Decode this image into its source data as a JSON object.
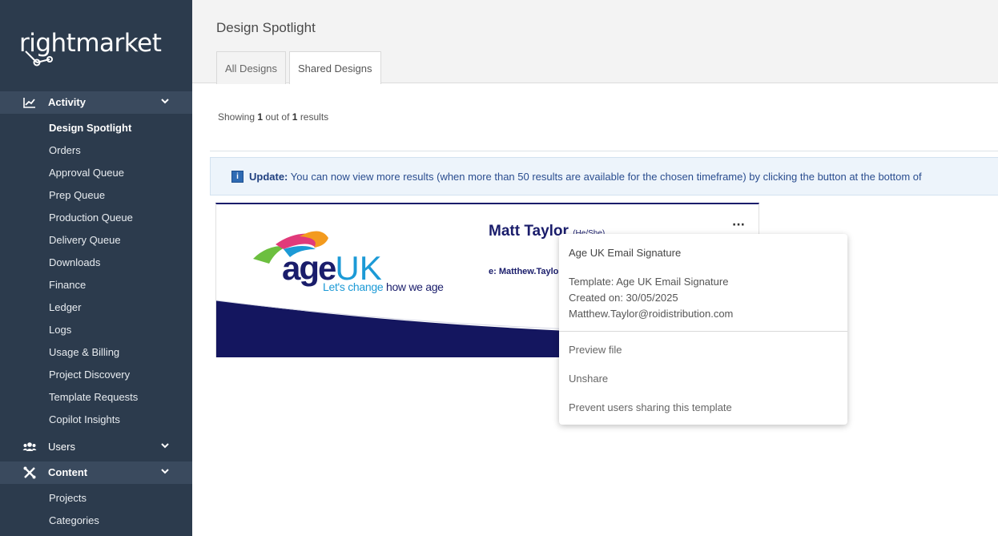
{
  "logo": {
    "text": "rightmarket"
  },
  "sidebar": {
    "activity": {
      "label": "Activity",
      "icon": "chart-line-icon"
    },
    "activity_items": [
      "Design Spotlight",
      "Orders",
      "Approval Queue",
      "Prep Queue",
      "Production Queue",
      "Delivery Queue",
      "Downloads",
      "Finance",
      "Ledger",
      "Logs",
      "Usage & Billing",
      "Project Discovery",
      "Template Requests",
      "Copilot Insights"
    ],
    "users": {
      "label": "Users",
      "icon": "users-icon"
    },
    "content": {
      "label": "Content",
      "icon": "tools-icon"
    },
    "content_items": [
      "Projects",
      "Categories"
    ]
  },
  "page": {
    "title": "Design Spotlight",
    "tabs": [
      "All Designs",
      "Shared Designs"
    ],
    "active_tab": "Shared Designs",
    "results": {
      "prefix": "Showing",
      "shown": "1",
      "middle": "out of",
      "total": "1",
      "suffix": "results"
    },
    "update": {
      "label": "Update:",
      "text": "You can now view more results (when more than 50 results are available for the chosen timeframe) by clicking the button at the bottom of"
    }
  },
  "card": {
    "sig_name": "Matt Taylor",
    "sig_pronoun": "(He/She)",
    "sig_email": "e: Matthew.Taylo",
    "logo_age": "age",
    "logo_uk": "UK",
    "tagline_a": "Let's change",
    "tagline_b": "how we age",
    "menu_glyph": "···"
  },
  "popup": {
    "title": "Age UK Email Signature",
    "template": "Template: Age UK Email Signature",
    "created": "Created on: 30/05/2025",
    "email": "Matthew.Taylor@roidistribution.com",
    "actions": [
      "Preview file",
      "Unshare",
      "Prevent users sharing this template"
    ]
  },
  "colors": {
    "sidebar_bg": "#2c3b4d",
    "navy": "#1a1d6b",
    "age_blue": "#1c9ad6"
  }
}
